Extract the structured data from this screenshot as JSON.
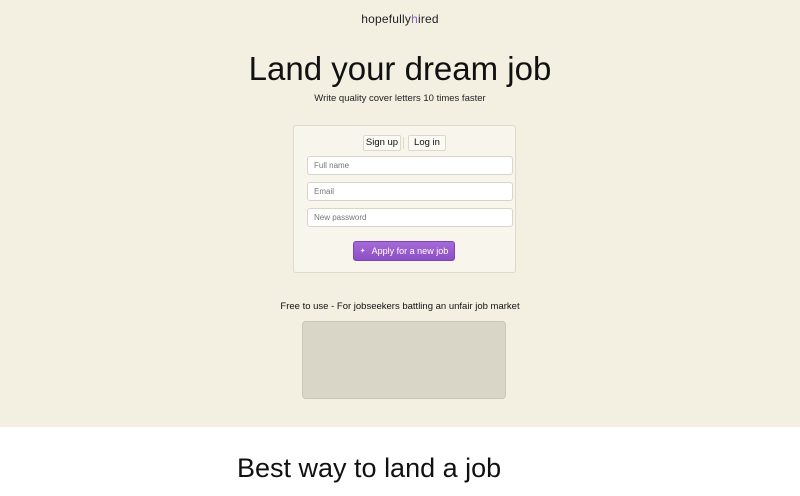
{
  "brand": {
    "logo_part1": "h",
    "logo_part2": "opefully",
    "logo_part3": "h",
    "logo_part4": "ired"
  },
  "hero": {
    "title": "Land your dream job",
    "subtitle": "Write quality cover letters 10 times faster"
  },
  "auth": {
    "tabs": {
      "signup": "Sign up",
      "login": "Log in"
    },
    "fields": {
      "full_name_placeholder": "Full name",
      "email_placeholder": "Email",
      "password_placeholder": "New password"
    },
    "submit_label": "Apply for a new job",
    "submit_icon": "sparkle-icon"
  },
  "tagline": "Free to use - For jobseekers battling an unfair job market",
  "section": {
    "heading": "Best way to land a job"
  },
  "colors": {
    "accent": "#8c4fc6",
    "hero_background": "#f3f0e2"
  }
}
